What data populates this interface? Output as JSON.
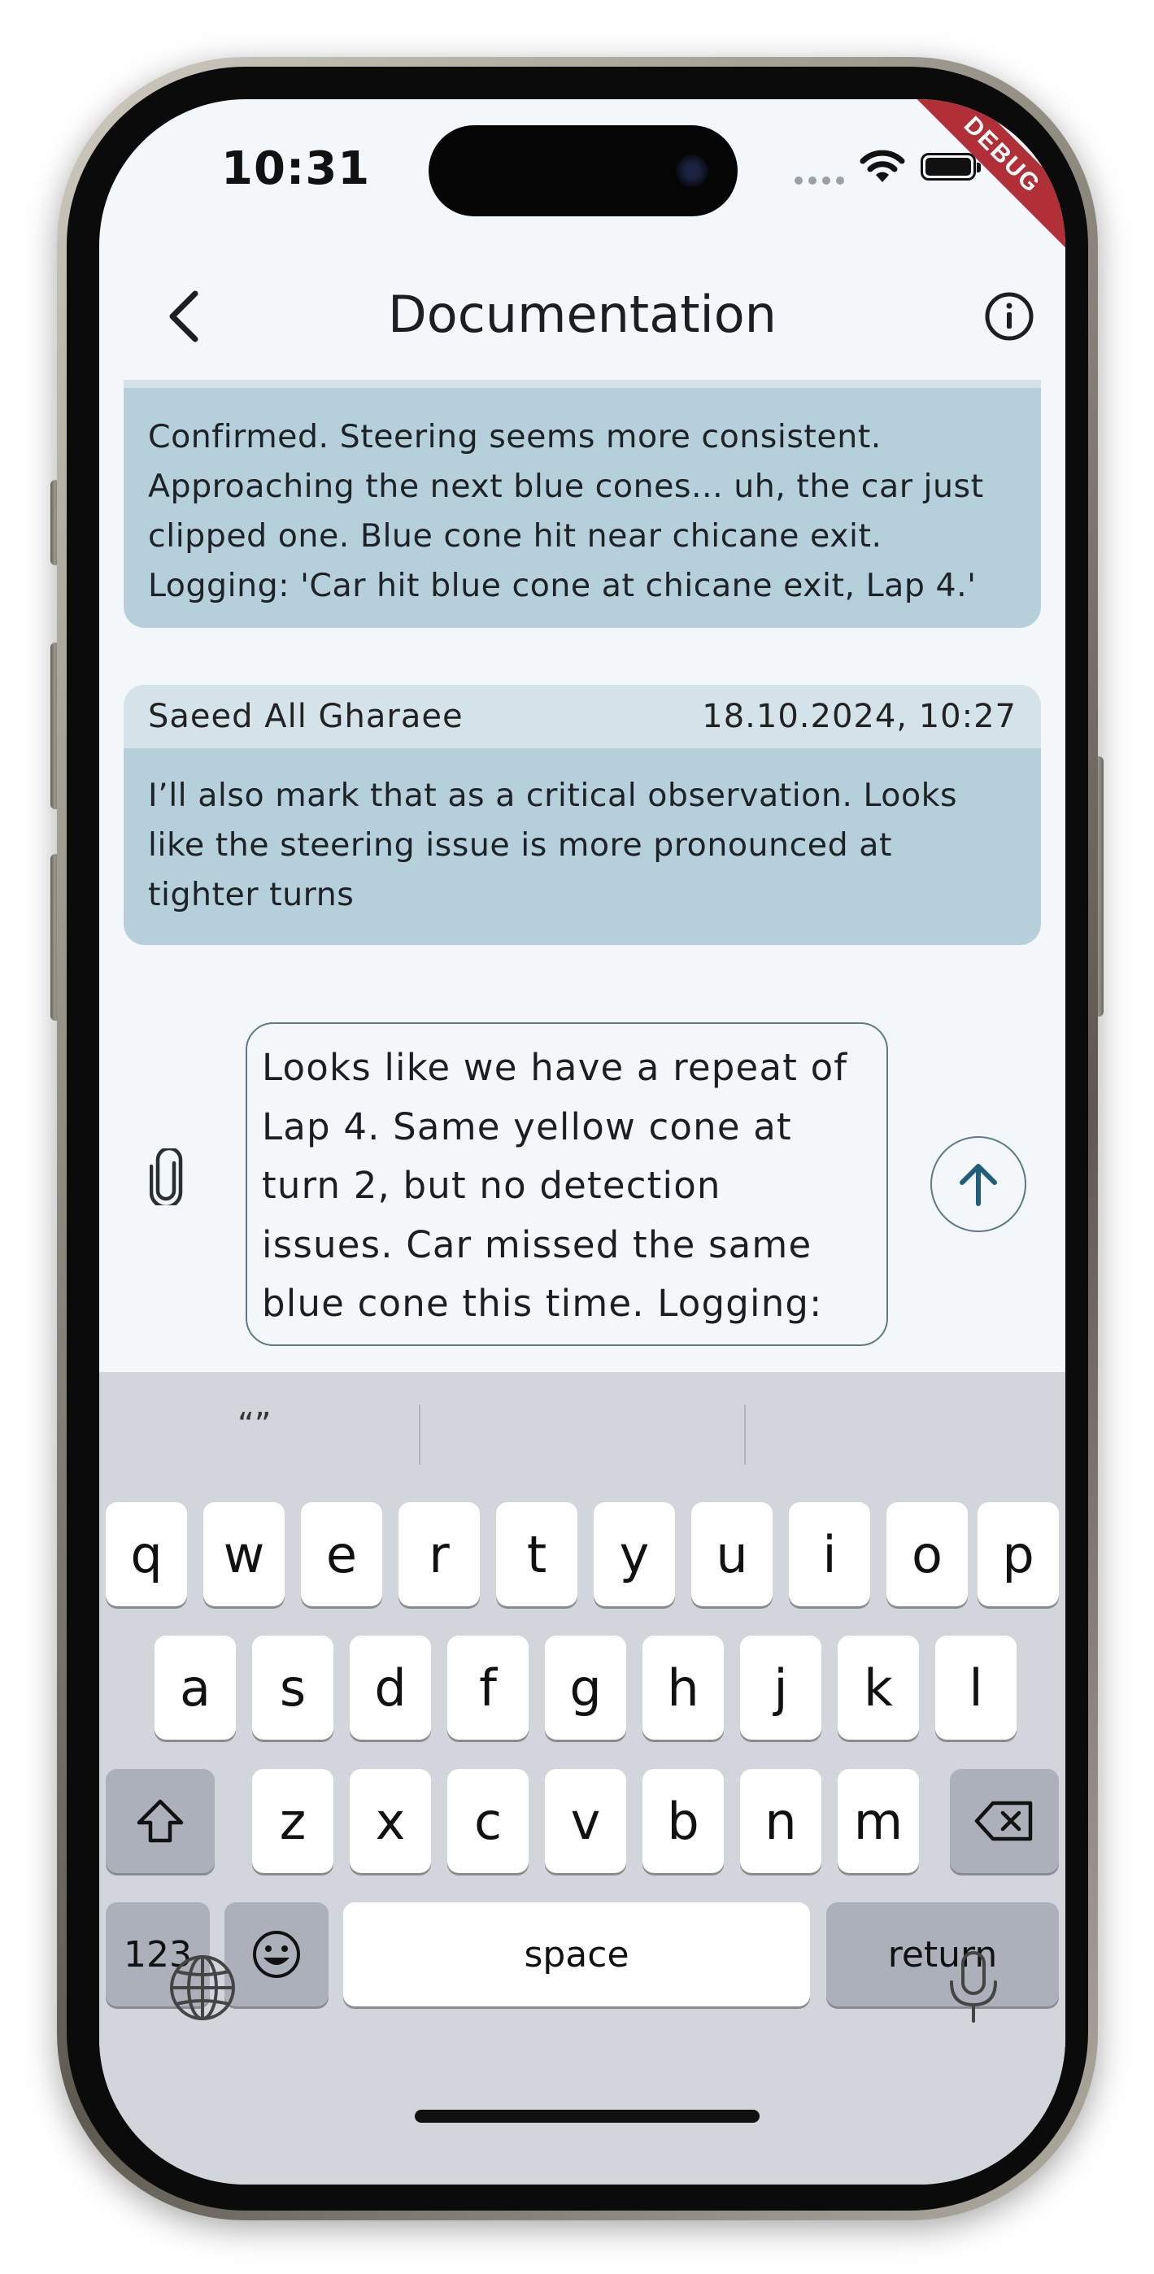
{
  "status_bar": {
    "time": "10:31",
    "debug_banner": "DEBUG"
  },
  "app_bar": {
    "title": "Documentation"
  },
  "messages": [
    {
      "author": "",
      "timestamp": "",
      "text": "Confirmed. Steering seems more consistent. Approaching the next blue cones... uh, the car just clipped one. Blue cone hit near chicane exit. Logging: 'Car hit blue cone at chicane exit, Lap 4.'",
      "lines": [
        "Confirmed. Steering seems more consistent.",
        "Approaching the next blue cones... uh, the car just",
        "clipped one. Blue cone hit near chicane exit.",
        "Logging: 'Car hit blue cone at chicane exit, Lap 4.'"
      ]
    },
    {
      "author": "Saeed All Gharaee",
      "timestamp": "18.10.2024, 10:27",
      "lines": [
        "I’ll also mark that as a critical observation. Looks",
        "like the steering issue is more pronounced at",
        "tighter turns"
      ]
    }
  ],
  "composer": {
    "lines": [
      "Looks like we have a repeat of",
      "Lap 4. Same yellow cone at",
      "turn 2, but no detection",
      "issues. Car missed the same",
      "blue cone this time. Logging:"
    ]
  },
  "keyboard": {
    "suggestion_1": "“”",
    "row1": [
      "q",
      "w",
      "e",
      "r",
      "t",
      "y",
      "u",
      "i",
      "o",
      "p"
    ],
    "row2": [
      "a",
      "s",
      "d",
      "f",
      "g",
      "h",
      "j",
      "k",
      "l"
    ],
    "row3": [
      "z",
      "x",
      "c",
      "v",
      "b",
      "n",
      "m"
    ],
    "numbers_key": "123",
    "space_key": "space",
    "return_key": "return"
  },
  "colors": {
    "bubble": "#b6d0db",
    "bubble_header": "#d4e3ea",
    "accent": "#1f5f7a",
    "debug": "#b12f36"
  }
}
